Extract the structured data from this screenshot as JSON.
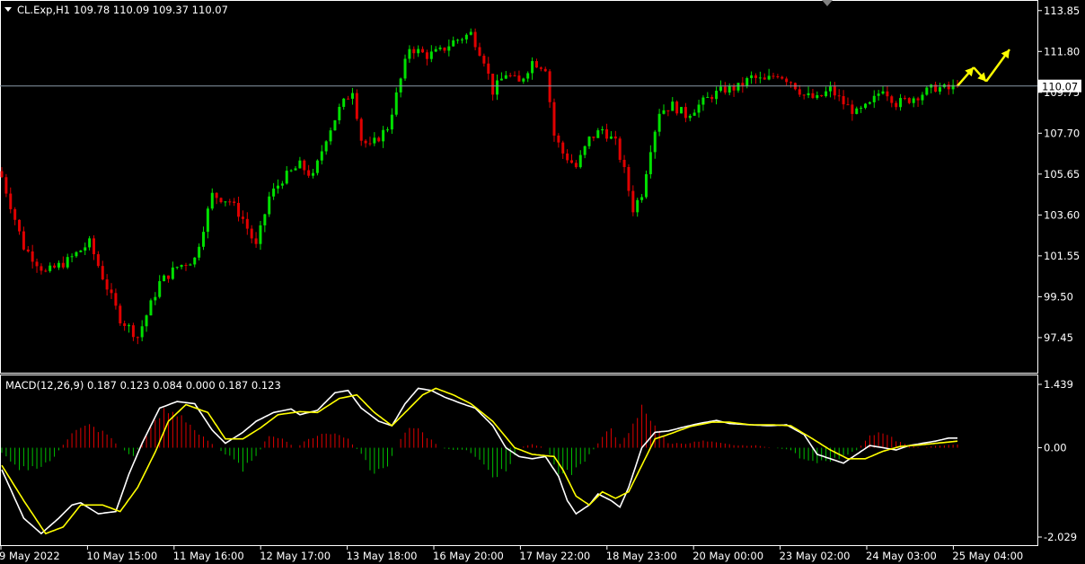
{
  "header": {
    "symbol": "CL.Exp,H1",
    "ohlc": "109.78 110.09 109.37 110.07"
  },
  "indicator": {
    "label": "MACD(12,26,9) 0.187 0.123 0.084 0.000 0.187 0.123"
  },
  "price_tag": "110.07",
  "colors": {
    "background": "#000000",
    "bull": "#00e000",
    "bear": "#e00000",
    "macd_line": "#ffffff",
    "signal_line": "#ffff00",
    "hist_pos": "#e00000",
    "hist_neg": "#00c000",
    "arrow": "#ffff00"
  },
  "chart_data": [
    {
      "type": "candlestick",
      "title": "CL.Exp,H1",
      "ylim": [
        96.5,
        114.2
      ],
      "y_ticks": [
        "113.85",
        "111.80",
        "109.75",
        "107.70",
        "105.65",
        "103.60",
        "101.55",
        "99.50",
        "97.45"
      ],
      "x_ticks": [
        "9 May 2022",
        "10 May 15:00",
        "11 May 16:00",
        "12 May 17:00",
        "13 May 18:00",
        "16 May 20:00",
        "17 May 22:00",
        "18 May 23:00",
        "20 May 00:00",
        "23 May 02:00",
        "24 May 03:00",
        "25 May 04:00"
      ],
      "last_price": 110.07,
      "close_path": [
        [
          0,
          105.5
        ],
        [
          5,
          102.0
        ],
        [
          10,
          100.7
        ],
        [
          15,
          101.3
        ],
        [
          20,
          102.2
        ],
        [
          23,
          100.5
        ],
        [
          27,
          98.4
        ],
        [
          31,
          97.5
        ],
        [
          36,
          100.2
        ],
        [
          40,
          101.0
        ],
        [
          44,
          101.4
        ],
        [
          48,
          104.6
        ],
        [
          52,
          104.3
        ],
        [
          55,
          103.4
        ],
        [
          58,
          102.0
        ],
        [
          61,
          104.5
        ],
        [
          64,
          105.4
        ],
        [
          68,
          106.1
        ],
        [
          71,
          105.5
        ],
        [
          74,
          107.5
        ],
        [
          77,
          108.9
        ],
        [
          80,
          109.9
        ],
        [
          82,
          107.4
        ],
        [
          84,
          107.0
        ],
        [
          88,
          108.0
        ],
        [
          90,
          109.6
        ],
        [
          93,
          112.0
        ],
        [
          97,
          111.6
        ],
        [
          100,
          111.8
        ],
        [
          103,
          112.3
        ],
        [
          107,
          112.7
        ],
        [
          110,
          111.4
        ],
        [
          112,
          109.8
        ],
        [
          115,
          110.7
        ],
        [
          118,
          110.2
        ],
        [
          121,
          111.3
        ],
        [
          124,
          111.0
        ],
        [
          126,
          107.6
        ],
        [
          128,
          106.7
        ],
        [
          131,
          106.0
        ],
        [
          134,
          107.4
        ],
        [
          137,
          107.9
        ],
        [
          140,
          107.2
        ],
        [
          142,
          105.8
        ],
        [
          144,
          103.9
        ],
        [
          146,
          104.7
        ],
        [
          148,
          107.0
        ],
        [
          150,
          108.8
        ],
        [
          153,
          109.1
        ],
        [
          156,
          108.6
        ],
        [
          159,
          109.1
        ],
        [
          162,
          109.6
        ],
        [
          165,
          109.9
        ],
        [
          168,
          110.0
        ],
        [
          171,
          110.5
        ],
        [
          174,
          110.3
        ],
        [
          177,
          110.7
        ],
        [
          180,
          110.3
        ],
        [
          183,
          109.6
        ],
        [
          186,
          109.4
        ],
        [
          189,
          109.9
        ],
        [
          192,
          109.2
        ],
        [
          195,
          108.7
        ],
        [
          198,
          109.1
        ],
        [
          201,
          110.0
        ],
        [
          204,
          109.2
        ],
        [
          207,
          109.4
        ],
        [
          210,
          109.7
        ],
        [
          213,
          110.0
        ],
        [
          216,
          109.9
        ],
        [
          218,
          110.07
        ]
      ],
      "arrows": [
        [
          110.07,
          111.0
        ],
        [
          111.0,
          110.3
        ],
        [
          110.3,
          111.9
        ]
      ]
    },
    {
      "type": "macd",
      "title": "MACD(12,26,9)",
      "ylim": [
        -2.029,
        1.439
      ],
      "y_ticks": [
        "1.439",
        "0.00",
        "-2.029"
      ],
      "macd": [
        [
          0,
          -0.5
        ],
        [
          5,
          -1.6
        ],
        [
          9,
          -1.95
        ],
        [
          13,
          -1.6
        ],
        [
          16,
          -1.3
        ],
        [
          18,
          -1.25
        ],
        [
          22,
          -1.5
        ],
        [
          26,
          -1.45
        ],
        [
          29,
          -0.6
        ],
        [
          32,
          0.1
        ],
        [
          36,
          0.9
        ],
        [
          40,
          1.05
        ],
        [
          44,
          1.0
        ],
        [
          48,
          0.4
        ],
        [
          51,
          0.1
        ],
        [
          55,
          0.35
        ],
        [
          58,
          0.6
        ],
        [
          62,
          0.8
        ],
        [
          66,
          0.88
        ],
        [
          68,
          0.75
        ],
        [
          72,
          0.85
        ],
        [
          76,
          1.25
        ],
        [
          79,
          1.3
        ],
        [
          82,
          0.9
        ],
        [
          86,
          0.6
        ],
        [
          89,
          0.5
        ],
        [
          92,
          1.0
        ],
        [
          95,
          1.35
        ],
        [
          98,
          1.3
        ],
        [
          101,
          1.15
        ],
        [
          105,
          1.0
        ],
        [
          108,
          0.9
        ],
        [
          112,
          0.5
        ],
        [
          115,
          0.0
        ],
        [
          118,
          -0.2
        ],
        [
          121,
          -0.25
        ],
        [
          124,
          -0.2
        ],
        [
          127,
          -0.65
        ],
        [
          129,
          -1.2
        ],
        [
          131,
          -1.5
        ],
        [
          134,
          -1.3
        ],
        [
          136,
          -1.05
        ],
        [
          139,
          -1.2
        ],
        [
          141,
          -1.35
        ],
        [
          143,
          -0.9
        ],
        [
          146,
          0.0
        ],
        [
          149,
          0.35
        ],
        [
          152,
          0.38
        ],
        [
          156,
          0.48
        ],
        [
          159,
          0.55
        ],
        [
          163,
          0.62
        ],
        [
          166,
          0.55
        ],
        [
          171,
          0.52
        ],
        [
          175,
          0.5
        ],
        [
          179,
          0.52
        ],
        [
          183,
          0.3
        ],
        [
          186,
          -0.15
        ],
        [
          189,
          -0.25
        ],
        [
          192,
          -0.35
        ],
        [
          195,
          -0.15
        ],
        [
          198,
          0.05
        ],
        [
          201,
          0.0
        ],
        [
          204,
          -0.05
        ],
        [
          207,
          0.05
        ],
        [
          210,
          0.1
        ],
        [
          213,
          0.15
        ],
        [
          216,
          0.22
        ],
        [
          218,
          0.22
        ]
      ],
      "signal": [
        [
          0,
          -0.4
        ],
        [
          5,
          -1.2
        ],
        [
          10,
          -1.95
        ],
        [
          14,
          -1.8
        ],
        [
          18,
          -1.3
        ],
        [
          23,
          -1.3
        ],
        [
          27,
          -1.45
        ],
        [
          31,
          -0.9
        ],
        [
          35,
          -0.1
        ],
        [
          38,
          0.6
        ],
        [
          42,
          0.98
        ],
        [
          47,
          0.8
        ],
        [
          51,
          0.2
        ],
        [
          55,
          0.2
        ],
        [
          59,
          0.45
        ],
        [
          63,
          0.75
        ],
        [
          68,
          0.82
        ],
        [
          72,
          0.8
        ],
        [
          77,
          1.12
        ],
        [
          81,
          1.2
        ],
        [
          85,
          0.8
        ],
        [
          89,
          0.5
        ],
        [
          93,
          0.9
        ],
        [
          96,
          1.2
        ],
        [
          99,
          1.35
        ],
        [
          103,
          1.2
        ],
        [
          107,
          1.0
        ],
        [
          112,
          0.6
        ],
        [
          117,
          0.0
        ],
        [
          121,
          -0.15
        ],
        [
          126,
          -0.2
        ],
        [
          128,
          -0.5
        ],
        [
          131,
          -1.1
        ],
        [
          134,
          -1.3
        ],
        [
          137,
          -1.0
        ],
        [
          140,
          -1.15
        ],
        [
          143,
          -1.0
        ],
        [
          146,
          -0.4
        ],
        [
          149,
          0.2
        ],
        [
          152,
          0.3
        ],
        [
          157,
          0.48
        ],
        [
          162,
          0.58
        ],
        [
          166,
          0.58
        ],
        [
          171,
          0.52
        ],
        [
          176,
          0.52
        ],
        [
          180,
          0.5
        ],
        [
          185,
          0.2
        ],
        [
          189,
          -0.05
        ],
        [
          193,
          -0.25
        ],
        [
          197,
          -0.25
        ],
        [
          201,
          -0.08
        ],
        [
          205,
          0.03
        ],
        [
          209,
          0.06
        ],
        [
          213,
          0.1
        ],
        [
          218,
          0.15
        ]
      ],
      "histogram": [
        [
          0,
          -0.1
        ],
        [
          4,
          -0.45
        ],
        [
          8,
          -0.5
        ],
        [
          12,
          -0.2
        ],
        [
          16,
          0.35
        ],
        [
          20,
          0.5
        ],
        [
          24,
          0.3
        ],
        [
          27,
          0.0
        ],
        [
          30,
          -0.2
        ],
        [
          33,
          0.3
        ],
        [
          37,
          0.82
        ],
        [
          41,
          0.75
        ],
        [
          45,
          0.3
        ],
        [
          49,
          0.0
        ],
        [
          52,
          -0.2
        ],
        [
          55,
          -0.5
        ],
        [
          58,
          -0.2
        ],
        [
          61,
          0.3
        ],
        [
          64,
          0.2
        ],
        [
          67,
          0.0
        ],
        [
          70,
          0.2
        ],
        [
          73,
          0.3
        ],
        [
          76,
          0.35
        ],
        [
          79,
          0.2
        ],
        [
          82,
          -0.15
        ],
        [
          85,
          -0.6
        ],
        [
          88,
          -0.4
        ],
        [
          91,
          0.2
        ],
        [
          94,
          0.5
        ],
        [
          97,
          0.25
        ],
        [
          100,
          0.0
        ],
        [
          103,
          -0.05
        ],
        [
          106,
          -0.05
        ],
        [
          109,
          -0.3
        ],
        [
          112,
          -0.6
        ],
        [
          115,
          -0.55
        ],
        [
          118,
          0.0
        ],
        [
          121,
          0.08
        ],
        [
          124,
          0.0
        ],
        [
          127,
          -0.55
        ],
        [
          130,
          -0.6
        ],
        [
          133,
          -0.3
        ],
        [
          136,
          0.1
        ],
        [
          139,
          0.45
        ],
        [
          141,
          0.1
        ],
        [
          143,
          0.3
        ],
        [
          146,
          0.9
        ],
        [
          149,
          0.55
        ],
        [
          152,
          0.1
        ],
        [
          156,
          0.1
        ],
        [
          160,
          0.15
        ],
        [
          164,
          0.1
        ],
        [
          168,
          0.05
        ],
        [
          172,
          0.05
        ],
        [
          176,
          0.0
        ],
        [
          180,
          -0.05
        ],
        [
          183,
          -0.3
        ],
        [
          186,
          -0.35
        ],
        [
          189,
          -0.3
        ],
        [
          192,
          -0.2
        ],
        [
          195,
          -0.05
        ],
        [
          198,
          0.25
        ],
        [
          201,
          0.35
        ],
        [
          204,
          0.15
        ],
        [
          207,
          0.05
        ],
        [
          210,
          0.0
        ],
        [
          213,
          0.05
        ],
        [
          216,
          0.06
        ],
        [
          218,
          0.07
        ]
      ]
    }
  ]
}
